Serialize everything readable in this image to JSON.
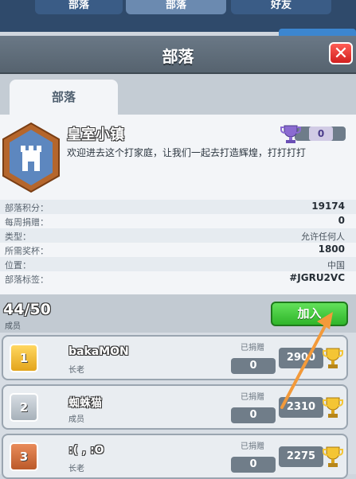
{
  "top_tabs": [
    {
      "label": "部落"
    },
    {
      "label": "部落"
    },
    {
      "label": "好友"
    }
  ],
  "dialog": {
    "title": "部落",
    "close_symbol": "✕",
    "active_tab": "部落"
  },
  "clan": {
    "name": "皇室小镇",
    "description": "欢迎进去这个打家庭，让我们一起去打造辉煌，打打打打",
    "trophies": "0",
    "stats": [
      {
        "label": "部落积分：",
        "value": "19174"
      },
      {
        "label": "每周捐赠：",
        "value": "0"
      },
      {
        "label": "类型：",
        "value": "允许任何人"
      },
      {
        "label": "所需奖杯：",
        "value": "1800"
      },
      {
        "label": "位置：",
        "value": "中国"
      },
      {
        "label": "部落标签：",
        "value": "#JGRU2VC"
      }
    ]
  },
  "members_header": {
    "count": "44/50",
    "label": "成员",
    "join_label": "加入"
  },
  "members": [
    {
      "rank": "1",
      "name": "bakaMON",
      "role": "长老",
      "donated_label": "已捐赠",
      "donated": "0",
      "trophies": "2900"
    },
    {
      "rank": "2",
      "name": "蜘蛛猫",
      "role": "成员",
      "donated_label": "已捐赠",
      "donated": "0",
      "trophies": "2310"
    },
    {
      "rank": "3",
      "name": ":( , :O",
      "role": "长老",
      "donated_label": "已捐赠",
      "donated": "0",
      "trophies": "2275"
    }
  ],
  "colors": {
    "header": "#56636f",
    "join": "#2fb52a",
    "close": "#d11f1f",
    "rank_gold": "#e3a51c",
    "rank_silver": "#a7b1ba",
    "rank_bronze": "#bb5a2a",
    "arrow": "#f39a3a"
  }
}
